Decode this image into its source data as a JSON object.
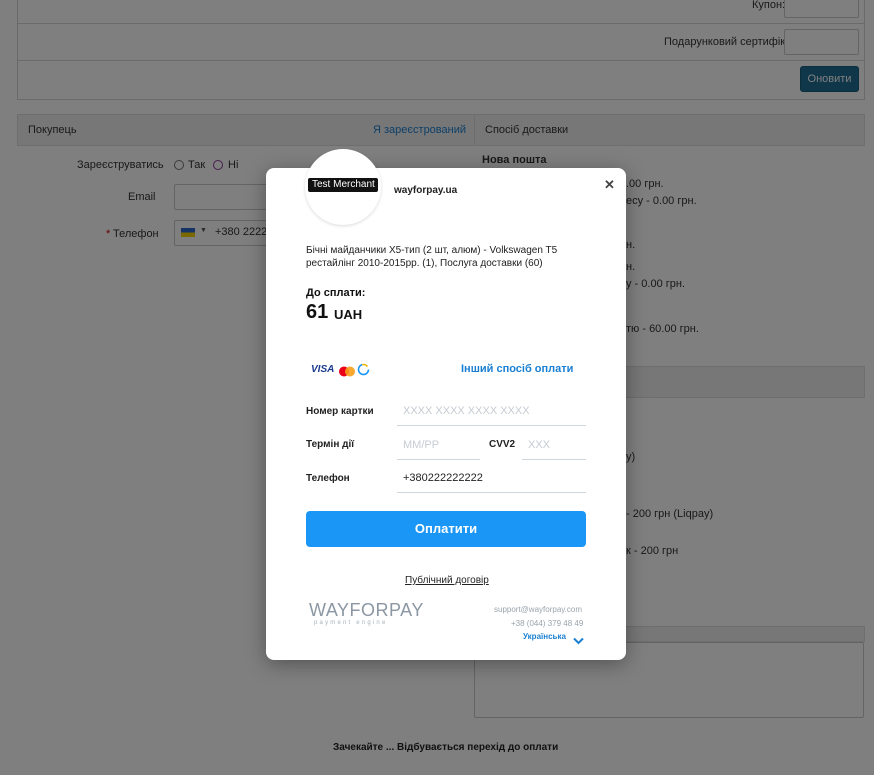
{
  "background": {
    "coupon_label": "Купон:",
    "certificate_label": "Подарунковий сертифікат:",
    "apply_button": "Оновити",
    "buyer_header": "Покупець",
    "registered_link": "Я зареєстрований",
    "register_label": "Зареєструватись",
    "register_yes": "Так",
    "register_no": "Ні",
    "email_label": "Email",
    "phone_label": "Телефон",
    "phone_required": "*",
    "phone_value": "+380 222222",
    "delivery_header": "Спосіб доставки",
    "delivery_title": "Нова пошта",
    "delivery_fragments": [
      ".00 грн.",
      "есу - 0.00 грн.",
      "н.",
      "н.",
      "у - 0.00 грн.",
      "тю - 60.00 грн."
    ],
    "payment_fragments": [
      "y)",
      "- 200 грн (Liqpay)",
      "к - 200 грн"
    ],
    "redirect_text": "Зачекайте ... Відбувається перехід до оплати"
  },
  "modal": {
    "merchant_logo_text": "Test Merchant",
    "site": "wayforpay.ua",
    "close_icon": "✕",
    "description": "Бічні майданчики X5-тип (2 шт, алюм) - Volkswagen T5 рестайлінг 2010-2015рр. (1), Послуга доставки (60)",
    "amount_label": "До сплати:",
    "amount": "61",
    "currency": "UAH",
    "other_method_link": "Інший спосіб оплати",
    "card_number_label": "Номер картки",
    "card_number_placeholder": "XXXX XXXX XXXX XXXX",
    "expiry_label": "Термін дії",
    "expiry_placeholder": "MM/PP",
    "cvv_label": "CVV2",
    "cvv_placeholder": "XXX",
    "phone_label": "Телефон",
    "phone_value": "+380222222222",
    "pay_button": "Оплатити",
    "contract_link": "Публічний договір",
    "brand_name": "WAYFORPAY",
    "brand_tagline": "payment engine",
    "support_email": "support@wayforpay.com",
    "support_phone": "+38 (044) 379 48 49",
    "language": "Українська",
    "card_brand_visa": "VISA"
  },
  "colors": {
    "pay_button": "#1a96f6",
    "link": "#1a7fd1",
    "apply_button": "#1f6e93"
  }
}
